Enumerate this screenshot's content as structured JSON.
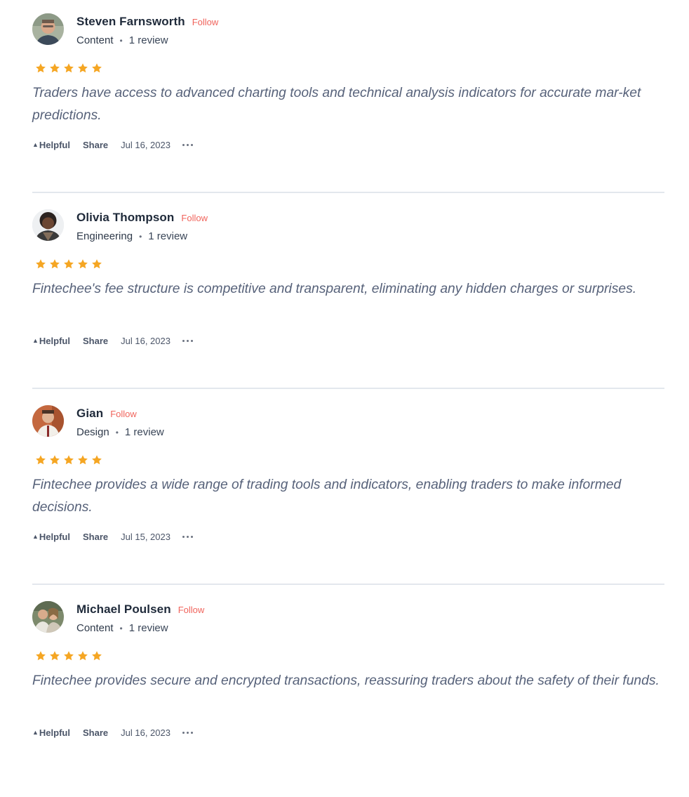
{
  "colors": {
    "accent_follow": "#f0645c",
    "star": "#f5a623",
    "divider": "#e3e7ed",
    "review_text": "#57627a"
  },
  "icons": {
    "star": "star-icon",
    "helpful_caret": "caret-up-icon",
    "more": "more-horizontal-icon"
  },
  "reviews": [
    {
      "name": "Steven Farnsworth",
      "follow_label": "Follow",
      "department": "Content",
      "separator": "•",
      "review_count": "1 review",
      "rating": 5,
      "text": "Traders have access to advanced charting tools and technical analysis indicators for accurate mar-ket predictions.",
      "helpful_label": "Helpful",
      "helpful_caret": "▲",
      "share_label": "Share",
      "date": "Jul 16, 2023"
    },
    {
      "name": "Olivia Thompson",
      "follow_label": "Follow",
      "department": "Engineering",
      "separator": "•",
      "review_count": "1 review",
      "rating": 5,
      "text": "Fintechee's fee structure is competitive and transparent, eliminating any hidden charges or surprises.",
      "helpful_label": "Helpful",
      "helpful_caret": "▲",
      "share_label": "Share",
      "date": "Jul 16, 2023"
    },
    {
      "name": "Gian",
      "follow_label": "Follow",
      "department": "Design",
      "separator": "•",
      "review_count": "1 review",
      "rating": 5,
      "text": "Fintechee provides a wide range of trading tools and indicators, enabling traders to make informed decisions.",
      "helpful_label": "Helpful",
      "helpful_caret": "▲",
      "share_label": "Share",
      "date": "Jul 15, 2023"
    },
    {
      "name": "Michael Poulsen",
      "follow_label": "Follow",
      "department": "Content",
      "separator": "•",
      "review_count": "1 review",
      "rating": 5,
      "text": "Fintechee provides secure and encrypted transactions, reassuring traders about the safety of their funds.",
      "helpful_label": "Helpful",
      "helpful_caret": "▲",
      "share_label": "Share",
      "date": "Jul 16, 2023"
    }
  ]
}
